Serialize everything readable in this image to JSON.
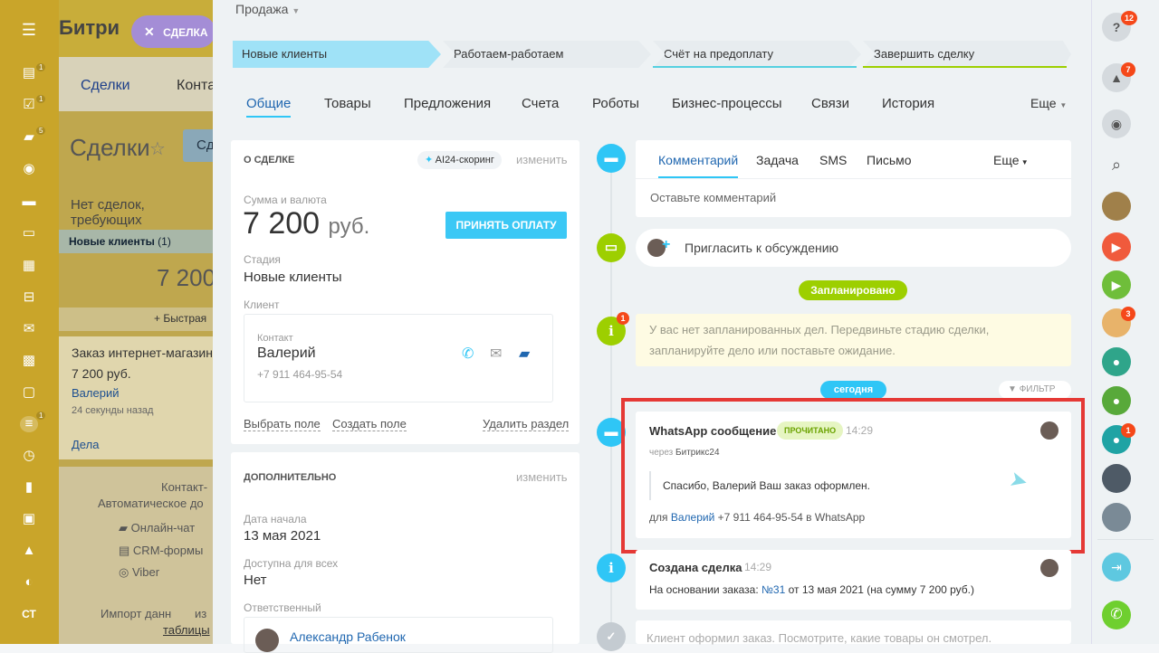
{
  "bg": {
    "app_title": "Битри",
    "tab_deals": "Сделки",
    "tab_contacts": "Конта",
    "page_title": "Сделки",
    "filter_btn": "Сд",
    "no_deals_note": "Нет сделок, требующих",
    "column_title": "Новые клиенты",
    "column_count": "(1)",
    "column_sum": "7 200",
    "quick_add": "+ Быстрая",
    "card_title": "Заказ интернет-магазин",
    "card_sum": "7 200 руб.",
    "card_client": "Валерий",
    "card_time": "24 секунды назад",
    "card_tasks": "Дела",
    "contact_block_title": "Контакт-",
    "contact_block_sub": "Автоматическое до",
    "channel_chat": "Онлайн-чат",
    "channel_forms": "CRM-формы",
    "channel_viber": "Viber",
    "import_text": "Импорт данн",
    "import_from": "из",
    "import_tables": "таблицы"
  },
  "leftbar": {
    "badges": [
      "1",
      "1",
      "5",
      "1"
    ],
    "ct_label": "СТ"
  },
  "pill": {
    "label": "СДЕЛКА"
  },
  "header": {
    "category": "Продажа"
  },
  "stages": [
    {
      "label": "Новые клиенты",
      "color": "#9fe2f7"
    },
    {
      "label": "Работаем-работаем",
      "color": "#e7ecef"
    },
    {
      "label": "Счёт на предоплату",
      "color": "#e7ecef"
    },
    {
      "label": "Завершить сделку",
      "color": "#e7ecef"
    }
  ],
  "tabs": [
    "Общие",
    "Товары",
    "Предложения",
    "Счета",
    "Роботы",
    "Бизнес-процессы",
    "Связи",
    "История"
  ],
  "tabs_more": "Еще",
  "about": {
    "title": "О СДЕЛКЕ",
    "scoring": "AI24-скоринг",
    "edit": "изменить",
    "amount_label": "Сумма и валюта",
    "amount": "7 200",
    "currency": "руб.",
    "pay_button": "ПРИНЯТЬ ОПЛАТУ",
    "stage_label": "Стадия",
    "stage_value": "Новые клиенты",
    "client_label": "Клиент",
    "contact_label": "Контакт",
    "contact_name": "Валерий",
    "contact_phone": "+7 911 464-95-54",
    "select_field": "Выбрать поле",
    "create_field": "Создать поле",
    "delete_section": "Удалить раздел"
  },
  "extra": {
    "title": "ДОПОЛНИТЕЛЬНО",
    "edit": "изменить",
    "start_label": "Дата начала",
    "start_value": "13 мая 2021",
    "access_label": "Доступна для всех",
    "access_value": "Нет",
    "resp_label": "Ответственный",
    "resp_name": "Александр Рабенок"
  },
  "activity": {
    "tabs": [
      "Комментарий",
      "Задача",
      "SMS",
      "Письмо"
    ],
    "more": "Еще",
    "placeholder": "Оставьте комментарий",
    "invite": "Пригласить к обсуждению"
  },
  "timeline": {
    "planned_badge": "Запланировано",
    "planned_counter": "1",
    "planned_text_1": "У вас нет запланированных дел. Передвиньте стадию сделки,",
    "planned_text_2": "запланируйте дело или поставьте ожидание.",
    "today_badge": "сегодня",
    "filter": "ФИЛЬТР",
    "wa_title": "WhatsApp сообщение",
    "wa_status": "прочитано",
    "wa_time": "14:29",
    "wa_via_prefix": "через",
    "wa_via": "Битрикс24",
    "wa_message": "Спасибо, Валерий Ваш заказ оформлен.",
    "wa_to_prefix": "для",
    "wa_to_name": "Валерий",
    "wa_to_rest": "+7 911 464-95-54 в WhatsApp",
    "created_title": "Создана сделка",
    "created_time": "14:29",
    "created_prefix": "На основании заказа:",
    "created_order": "№31",
    "created_rest": "от 13 мая 2021 (на сумму 7 200 руб.)",
    "bottom_text": "Клиент оформил заказ. Посмотрите, какие товары он смотрел."
  },
  "rightbar": {
    "help_badge": "12",
    "bell_badge": "7",
    "user3_badge": "3",
    "user6_badge": "1"
  },
  "colors": {
    "accent": "#2fc6f6",
    "green": "#9dcf00",
    "highlight": "#e53935",
    "link": "#2067b0"
  }
}
